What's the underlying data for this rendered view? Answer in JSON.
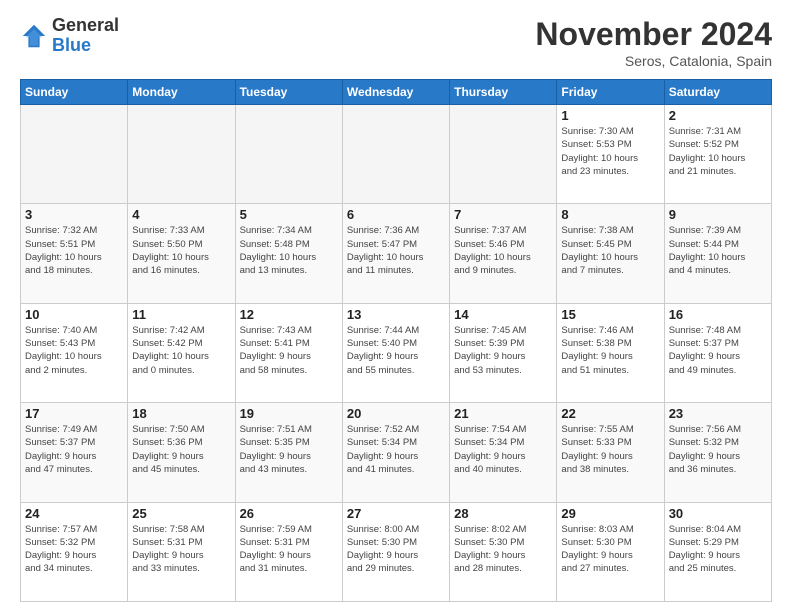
{
  "logo": {
    "text_general": "General",
    "text_blue": "Blue"
  },
  "header": {
    "month_title": "November 2024",
    "location": "Seros, Catalonia, Spain"
  },
  "weekdays": [
    "Sunday",
    "Monday",
    "Tuesday",
    "Wednesday",
    "Thursday",
    "Friday",
    "Saturday"
  ],
  "weeks": [
    [
      {
        "day": "",
        "info": ""
      },
      {
        "day": "",
        "info": ""
      },
      {
        "day": "",
        "info": ""
      },
      {
        "day": "",
        "info": ""
      },
      {
        "day": "",
        "info": ""
      },
      {
        "day": "1",
        "info": "Sunrise: 7:30 AM\nSunset: 5:53 PM\nDaylight: 10 hours\nand 23 minutes."
      },
      {
        "day": "2",
        "info": "Sunrise: 7:31 AM\nSunset: 5:52 PM\nDaylight: 10 hours\nand 21 minutes."
      }
    ],
    [
      {
        "day": "3",
        "info": "Sunrise: 7:32 AM\nSunset: 5:51 PM\nDaylight: 10 hours\nand 18 minutes."
      },
      {
        "day": "4",
        "info": "Sunrise: 7:33 AM\nSunset: 5:50 PM\nDaylight: 10 hours\nand 16 minutes."
      },
      {
        "day": "5",
        "info": "Sunrise: 7:34 AM\nSunset: 5:48 PM\nDaylight: 10 hours\nand 13 minutes."
      },
      {
        "day": "6",
        "info": "Sunrise: 7:36 AM\nSunset: 5:47 PM\nDaylight: 10 hours\nand 11 minutes."
      },
      {
        "day": "7",
        "info": "Sunrise: 7:37 AM\nSunset: 5:46 PM\nDaylight: 10 hours\nand 9 minutes."
      },
      {
        "day": "8",
        "info": "Sunrise: 7:38 AM\nSunset: 5:45 PM\nDaylight: 10 hours\nand 7 minutes."
      },
      {
        "day": "9",
        "info": "Sunrise: 7:39 AM\nSunset: 5:44 PM\nDaylight: 10 hours\nand 4 minutes."
      }
    ],
    [
      {
        "day": "10",
        "info": "Sunrise: 7:40 AM\nSunset: 5:43 PM\nDaylight: 10 hours\nand 2 minutes."
      },
      {
        "day": "11",
        "info": "Sunrise: 7:42 AM\nSunset: 5:42 PM\nDaylight: 10 hours\nand 0 minutes."
      },
      {
        "day": "12",
        "info": "Sunrise: 7:43 AM\nSunset: 5:41 PM\nDaylight: 9 hours\nand 58 minutes."
      },
      {
        "day": "13",
        "info": "Sunrise: 7:44 AM\nSunset: 5:40 PM\nDaylight: 9 hours\nand 55 minutes."
      },
      {
        "day": "14",
        "info": "Sunrise: 7:45 AM\nSunset: 5:39 PM\nDaylight: 9 hours\nand 53 minutes."
      },
      {
        "day": "15",
        "info": "Sunrise: 7:46 AM\nSunset: 5:38 PM\nDaylight: 9 hours\nand 51 minutes."
      },
      {
        "day": "16",
        "info": "Sunrise: 7:48 AM\nSunset: 5:37 PM\nDaylight: 9 hours\nand 49 minutes."
      }
    ],
    [
      {
        "day": "17",
        "info": "Sunrise: 7:49 AM\nSunset: 5:37 PM\nDaylight: 9 hours\nand 47 minutes."
      },
      {
        "day": "18",
        "info": "Sunrise: 7:50 AM\nSunset: 5:36 PM\nDaylight: 9 hours\nand 45 minutes."
      },
      {
        "day": "19",
        "info": "Sunrise: 7:51 AM\nSunset: 5:35 PM\nDaylight: 9 hours\nand 43 minutes."
      },
      {
        "day": "20",
        "info": "Sunrise: 7:52 AM\nSunset: 5:34 PM\nDaylight: 9 hours\nand 41 minutes."
      },
      {
        "day": "21",
        "info": "Sunrise: 7:54 AM\nSunset: 5:34 PM\nDaylight: 9 hours\nand 40 minutes."
      },
      {
        "day": "22",
        "info": "Sunrise: 7:55 AM\nSunset: 5:33 PM\nDaylight: 9 hours\nand 38 minutes."
      },
      {
        "day": "23",
        "info": "Sunrise: 7:56 AM\nSunset: 5:32 PM\nDaylight: 9 hours\nand 36 minutes."
      }
    ],
    [
      {
        "day": "24",
        "info": "Sunrise: 7:57 AM\nSunset: 5:32 PM\nDaylight: 9 hours\nand 34 minutes."
      },
      {
        "day": "25",
        "info": "Sunrise: 7:58 AM\nSunset: 5:31 PM\nDaylight: 9 hours\nand 33 minutes."
      },
      {
        "day": "26",
        "info": "Sunrise: 7:59 AM\nSunset: 5:31 PM\nDaylight: 9 hours\nand 31 minutes."
      },
      {
        "day": "27",
        "info": "Sunrise: 8:00 AM\nSunset: 5:30 PM\nDaylight: 9 hours\nand 29 minutes."
      },
      {
        "day": "28",
        "info": "Sunrise: 8:02 AM\nSunset: 5:30 PM\nDaylight: 9 hours\nand 28 minutes."
      },
      {
        "day": "29",
        "info": "Sunrise: 8:03 AM\nSunset: 5:30 PM\nDaylight: 9 hours\nand 27 minutes."
      },
      {
        "day": "30",
        "info": "Sunrise: 8:04 AM\nSunset: 5:29 PM\nDaylight: 9 hours\nand 25 minutes."
      }
    ]
  ]
}
